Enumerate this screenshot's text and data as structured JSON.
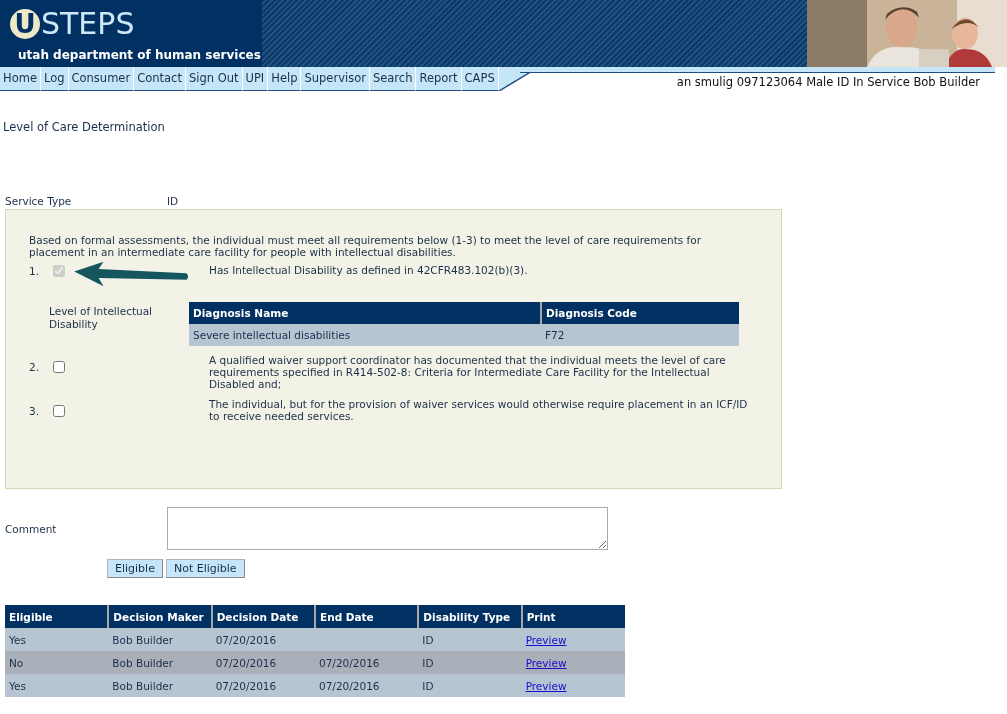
{
  "header": {
    "logo_mark": "U",
    "logo_name": "STEPS",
    "subtitle": "utah department of human services"
  },
  "nav": {
    "items": [
      "Home",
      "Log",
      "Consumer",
      "Contact",
      "Sign Out",
      "UPI",
      "Help",
      "Supervisor",
      "Search",
      "Report",
      "CAPS"
    ],
    "consumer_info": "an smulig 097123064 Male ID In Service Bob Builder"
  },
  "page_title": "Level of Care Determination",
  "service_type": {
    "label": "Service Type",
    "value": "ID"
  },
  "requirements": {
    "intro": "Based on formal assessments, the individual must meet all requirements below (1-3) to meet the level of care requirements for placement in an intermediate care facility for people with intellectual disabilities.",
    "items": [
      {
        "number": "1.",
        "checked": true,
        "disabled": true,
        "text": "Has Intellectual Disability as defined in 42CFR483.102(b)(3)."
      },
      {
        "number": "2.",
        "checked": false,
        "disabled": false,
        "text": "A qualified waiver support coordinator has documented that the individual meets the level of care requirements specified in R414-502-8: Criteria for Intermediate Care Facility for the Intellectual Disabled and;"
      },
      {
        "number": "3.",
        "checked": false,
        "disabled": false,
        "text": "The individual, but for the provision of waiver services would otherwise require placement in an ICF/ID to receive needed services."
      }
    ],
    "diagnosis": {
      "label": "Level of Intellectual Disability",
      "columns": [
        "Diagnosis Name",
        "Diagnosis Code"
      ],
      "rows": [
        [
          "Severe intellectual disabilities",
          "F72"
        ]
      ]
    }
  },
  "comment": {
    "label": "Comment"
  },
  "buttons": [
    "Eligible",
    "Not Eligible"
  ],
  "history": {
    "columns": [
      "Eligible",
      "Decision Maker",
      "Decision Date",
      "End Date",
      "Disability Type",
      "Print"
    ],
    "rows": [
      {
        "cells": [
          "Yes",
          "Bob Builder",
          "07/20/2016",
          "",
          "ID"
        ],
        "link": "Preview"
      },
      {
        "cells": [
          "No",
          "Bob Builder",
          "07/20/2016",
          "07/20/2016",
          "ID"
        ],
        "link": "Preview"
      },
      {
        "cells": [
          "Yes",
          "Bob Builder",
          "07/20/2016",
          "07/20/2016",
          "ID"
        ],
        "link": "Preview"
      }
    ]
  }
}
